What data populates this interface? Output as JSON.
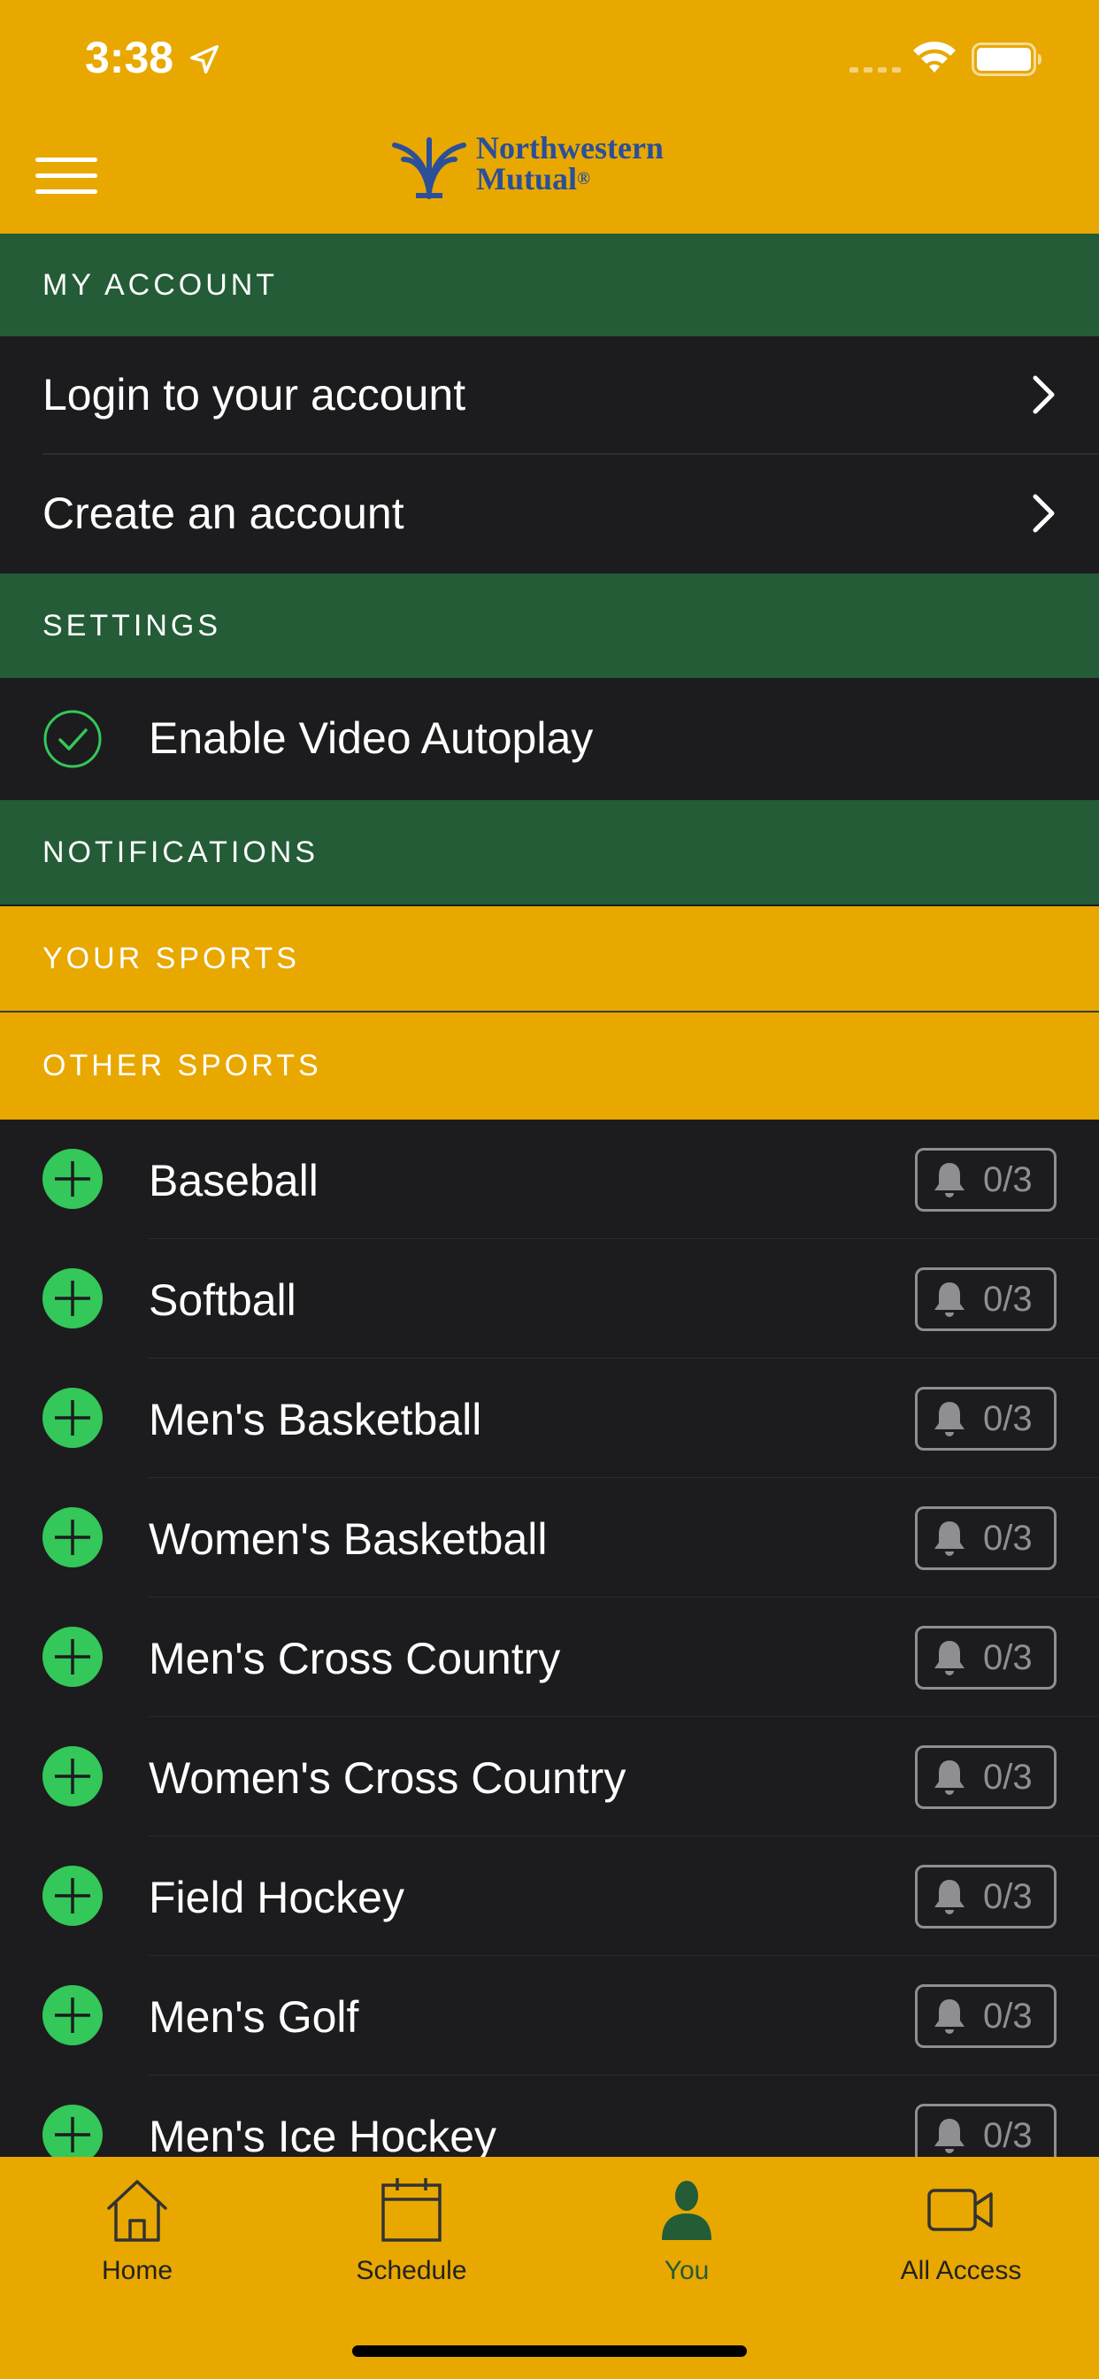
{
  "status_bar": {
    "time": "3:38"
  },
  "brand": {
    "line1": "Northwestern",
    "line2": "Mutual",
    "mark": "®"
  },
  "my_account": {
    "title": "MY ACCOUNT",
    "items": [
      {
        "label": "Login to your account"
      },
      {
        "label": "Create an account"
      }
    ]
  },
  "settings": {
    "title": "SETTINGS",
    "autoplay_label": "Enable Video Autoplay",
    "autoplay_enabled": true
  },
  "notifications": {
    "title": "NOTIFICATIONS"
  },
  "your_sports": {
    "title": "YOUR SPORTS"
  },
  "other_sports": {
    "title": "OTHER SPORTS",
    "items": [
      {
        "name": "Baseball",
        "count": "0/3"
      },
      {
        "name": "Softball",
        "count": "0/3"
      },
      {
        "name": "Men's Basketball",
        "count": "0/3"
      },
      {
        "name": "Women's Basketball",
        "count": "0/3"
      },
      {
        "name": "Men's Cross Country",
        "count": "0/3"
      },
      {
        "name": "Women's Cross Country",
        "count": "0/3"
      },
      {
        "name": "Field Hockey",
        "count": "0/3"
      },
      {
        "name": "Men's Golf",
        "count": "0/3"
      },
      {
        "name": "Men's Ice Hockey",
        "count": "0/3"
      }
    ]
  },
  "tabbar": {
    "tabs": [
      {
        "label": "Home",
        "icon": "home-icon",
        "active": false
      },
      {
        "label": "Schedule",
        "icon": "calendar-icon",
        "active": false
      },
      {
        "label": "You",
        "icon": "person-icon",
        "active": true
      },
      {
        "label": "All Access",
        "icon": "video-icon",
        "active": false
      }
    ]
  },
  "colors": {
    "brand_yellow": "#e8a800",
    "section_green": "#235c36",
    "background": "#1c1c1e",
    "accent_green": "#34c759"
  }
}
